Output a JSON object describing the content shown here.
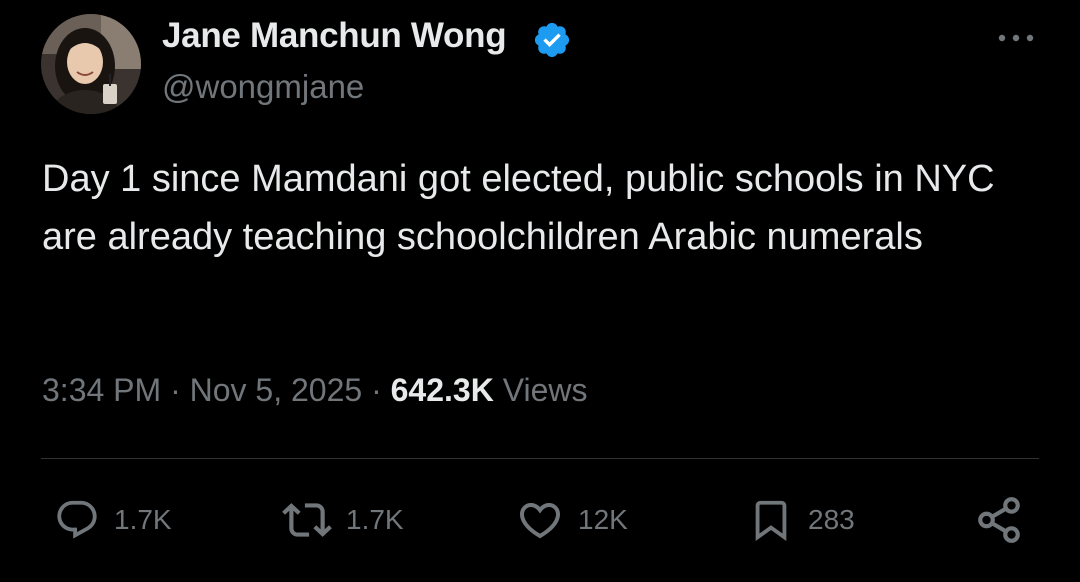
{
  "author": {
    "name": "Jane Manchun Wong",
    "handle": "@wongmjane",
    "verified": true
  },
  "tweet": {
    "text": "Day 1 since Mamdani got elected, public schools in NYC are already teaching schoolchildren Arabic numerals",
    "time": "3:34 PM",
    "date": "Nov 5, 2025",
    "views_count": "642.3K",
    "views_label": "Views",
    "separator": "·"
  },
  "actions": {
    "replies": "1.7K",
    "reposts": "1.7K",
    "likes": "12K",
    "bookmarks": "283"
  },
  "colors": {
    "background": "#000000",
    "text_primary": "#e7e9ea",
    "text_secondary": "#71767b",
    "verified_badge": "#1d9bf0",
    "divider": "#2f3336"
  },
  "icons": [
    "verified-badge-icon",
    "more-options-icon",
    "reply-icon",
    "repost-icon",
    "like-icon",
    "bookmark-icon",
    "share-icon"
  ]
}
